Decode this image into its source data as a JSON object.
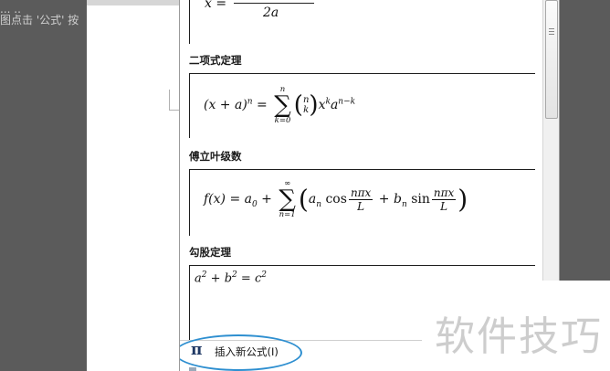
{
  "background_doc": {
    "text_line1": "... ..",
    "text_line2": "图点击 '公式' 按"
  },
  "equation_gallery": {
    "fragment": {
      "lhs": "x =",
      "denominator": "2a"
    },
    "categories": [
      {
        "title": "二项式定理"
      },
      {
        "title": "傅立叶级数"
      },
      {
        "title": "勾股定理"
      }
    ],
    "binomial": {
      "lhs": "(x + a)",
      "sup_n": "n",
      "eq": "=",
      "sum_top": "n",
      "sum_bottom": "k=0",
      "binom_top": "n",
      "binom_bottom": "k",
      "term_x": "x",
      "sup_k": "k",
      "term_a": "a",
      "sup_nk": "n−k"
    },
    "fourier": {
      "lhs": "f(x) = a",
      "sub0": "0",
      "plus": "+",
      "sum_top": "∞",
      "sum_bottom": "n=1",
      "an": "a",
      "sub_n": "n",
      "cos": "cos",
      "frac_num": "nπx",
      "frac_den": "L",
      "plus2": "+",
      "bn": "b",
      "sub_n2": "n",
      "sin": "sin",
      "frac_num2": "nπx",
      "frac_den2": "L"
    },
    "pythagoras": {
      "a": "a",
      "sup2a": "2",
      "plus": "+",
      "b": "b",
      "sup2b": "2",
      "eq": "=",
      "c": "c",
      "sup2c": "2"
    }
  },
  "insert_button": {
    "icon": "pi-icon",
    "label": "插入新公式(I)"
  },
  "watermark": "软件技巧",
  "colors": {
    "highlight_ellipse": "#2e8fd0",
    "pi_icon": "#1f3864"
  }
}
